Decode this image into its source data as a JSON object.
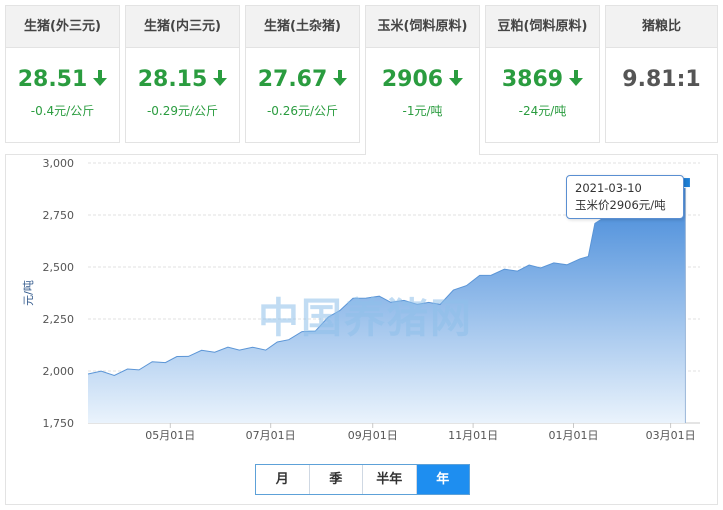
{
  "cards": [
    {
      "title": "生猪(外三元)",
      "price": "28.51",
      "change": "-0.4元/公斤",
      "trend": "down"
    },
    {
      "title": "生猪(内三元)",
      "price": "28.15",
      "change": "-0.29元/公斤",
      "trend": "down"
    },
    {
      "title": "生猪(土杂猪)",
      "price": "27.67",
      "change": "-0.26元/公斤",
      "trend": "down"
    },
    {
      "title": "玉米(饲料原料)",
      "price": "2906",
      "change": "-1元/吨",
      "trend": "down"
    },
    {
      "title": "豆粕(饲料原料)",
      "price": "3869",
      "change": "-24元/吨",
      "trend": "down"
    },
    {
      "title": "猪粮比",
      "price": "9.81:1",
      "change": "",
      "trend": "none"
    }
  ],
  "active_card": 3,
  "colors": {
    "down": "#2a9c3f",
    "area_top": "#3d85d8",
    "area_bottom": "#eaf3fc",
    "line": "#5b95d6",
    "marker": "#1e7fd6"
  },
  "watermark": "中国养猪网",
  "tooltip": {
    "date": "2021-03-10",
    "label": "玉米价2906元/吨"
  },
  "range_buttons": [
    {
      "label": "月",
      "active": false
    },
    {
      "label": "季",
      "active": false
    },
    {
      "label": "半年",
      "active": false
    },
    {
      "label": "年",
      "active": true
    }
  ],
  "chart_data": {
    "type": "area",
    "title": "",
    "xlabel": "",
    "ylabel": "元/吨",
    "ylim": [
      1750,
      3000
    ],
    "yticks": [
      1750,
      2000,
      2250,
      2500,
      2750,
      3000
    ],
    "ytick_labels": [
      "1,750",
      "2,000",
      "2,250",
      "2,500",
      "2,750",
      "3,000"
    ],
    "xlim": [
      "2020-03-12",
      "2021-03-14"
    ],
    "xticks": [
      {
        "date": "2020-05-01",
        "label": "05月01日"
      },
      {
        "date": "2020-07-01",
        "label": "07月01日"
      },
      {
        "date": "2020-09-01",
        "label": "09月01日"
      },
      {
        "date": "2020-11-01",
        "label": "11月01日"
      },
      {
        "date": "2021-01-01",
        "label": "01月01日"
      },
      {
        "date": "2021-03-01",
        "label": "03月01日"
      }
    ],
    "grid": true,
    "series": [
      {
        "values": [
          [
            "2020-03-12",
            1995
          ],
          [
            "2020-03-20",
            1990
          ],
          [
            "2020-03-28",
            1988
          ],
          [
            "2020-04-05",
            2000
          ],
          [
            "2020-04-12",
            2015
          ],
          [
            "2020-04-20",
            2035
          ],
          [
            "2020-04-28",
            2050
          ],
          [
            "2020-05-05",
            2060
          ],
          [
            "2020-05-12",
            2080
          ],
          [
            "2020-05-20",
            2090
          ],
          [
            "2020-05-28",
            2100
          ],
          [
            "2020-06-05",
            2105
          ],
          [
            "2020-06-12",
            2110
          ],
          [
            "2020-06-20",
            2105
          ],
          [
            "2020-06-28",
            2110
          ],
          [
            "2020-07-05",
            2130
          ],
          [
            "2020-07-12",
            2160
          ],
          [
            "2020-07-20",
            2180
          ],
          [
            "2020-07-28",
            2200
          ],
          [
            "2020-08-05",
            2250
          ],
          [
            "2020-08-12",
            2300
          ],
          [
            "2020-08-20",
            2340
          ],
          [
            "2020-08-28",
            2360
          ],
          [
            "2020-09-05",
            2350
          ],
          [
            "2020-09-12",
            2340
          ],
          [
            "2020-09-20",
            2330
          ],
          [
            "2020-09-28",
            2330
          ],
          [
            "2020-10-05",
            2320
          ],
          [
            "2020-10-12",
            2330
          ],
          [
            "2020-10-20",
            2380
          ],
          [
            "2020-10-28",
            2420
          ],
          [
            "2020-11-05",
            2450
          ],
          [
            "2020-11-12",
            2470
          ],
          [
            "2020-11-20",
            2480
          ],
          [
            "2020-11-28",
            2490
          ],
          [
            "2020-12-05",
            2500
          ],
          [
            "2020-12-12",
            2505
          ],
          [
            "2020-12-20",
            2510
          ],
          [
            "2020-12-28",
            2520
          ],
          [
            "2021-01-05",
            2530
          ],
          [
            "2021-01-10",
            2560
          ],
          [
            "2021-01-14",
            2700
          ],
          [
            "2021-01-20",
            2750
          ],
          [
            "2021-01-28",
            2780
          ],
          [
            "2021-02-05",
            2810
          ],
          [
            "2021-02-12",
            2830
          ],
          [
            "2021-02-20",
            2850
          ],
          [
            "2021-02-28",
            2870
          ],
          [
            "2021-03-05",
            2880
          ],
          [
            "2021-03-10",
            2906
          ]
        ]
      }
    ]
  }
}
